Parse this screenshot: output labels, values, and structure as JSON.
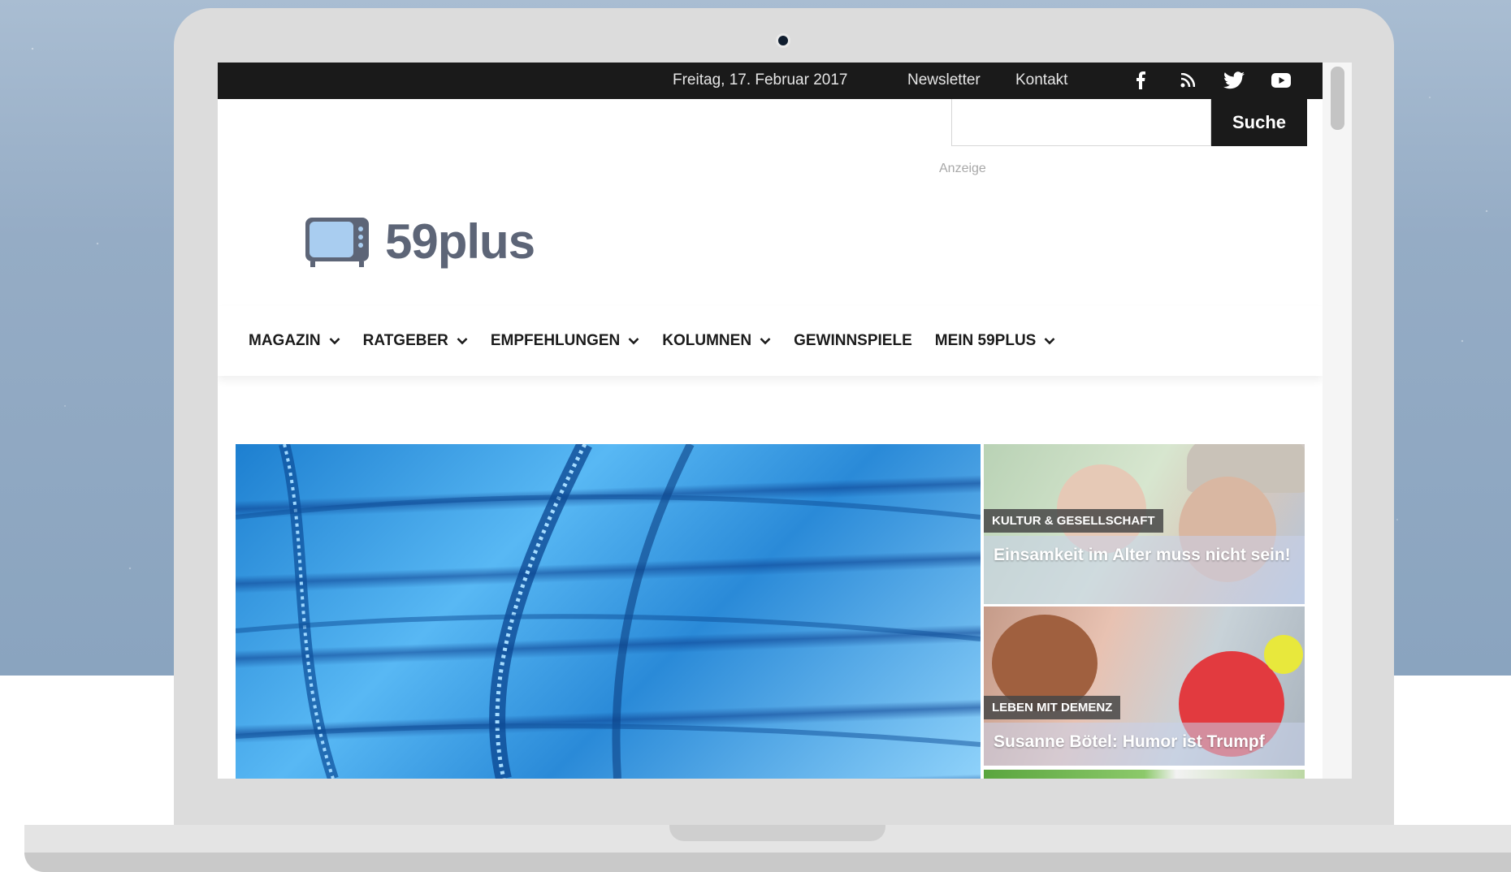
{
  "topbar": {
    "date": "Freitag, 17. Februar 2017",
    "links": [
      "Newsletter",
      "Kontakt"
    ],
    "social_icons": [
      "facebook-icon",
      "rss-icon",
      "twitter-icon",
      "youtube-icon"
    ]
  },
  "search": {
    "placeholder": "",
    "button_label": "Suche"
  },
  "ad_label": "Anzeige",
  "logo": {
    "text": "59plus",
    "icon": "tv-icon"
  },
  "nav": {
    "items": [
      {
        "label": "MAGAZIN",
        "dropdown": true
      },
      {
        "label": "RATGEBER",
        "dropdown": true
      },
      {
        "label": "EMPFEHLUNGEN",
        "dropdown": true
      },
      {
        "label": "KOLUMNEN",
        "dropdown": true
      },
      {
        "label": "GEWINNSPIELE",
        "dropdown": false
      },
      {
        "label": "MEIN 59PLUS",
        "dropdown": true
      }
    ]
  },
  "featured": {
    "cards": [
      {
        "category": "KULTUR & GESELLSCHAFT",
        "title": "Einsamkeit im Alter muss nicht sein!"
      },
      {
        "category": "LEBEN MIT DEMENZ",
        "title": "Susanne Bötel: Humor ist Trumpf"
      }
    ]
  },
  "colors": {
    "topbar_bg": "#1a1a1a",
    "logo_text": "#5d6577",
    "logo_icon": "#a9cdf0",
    "hero_blue": "#2a8ad8"
  }
}
